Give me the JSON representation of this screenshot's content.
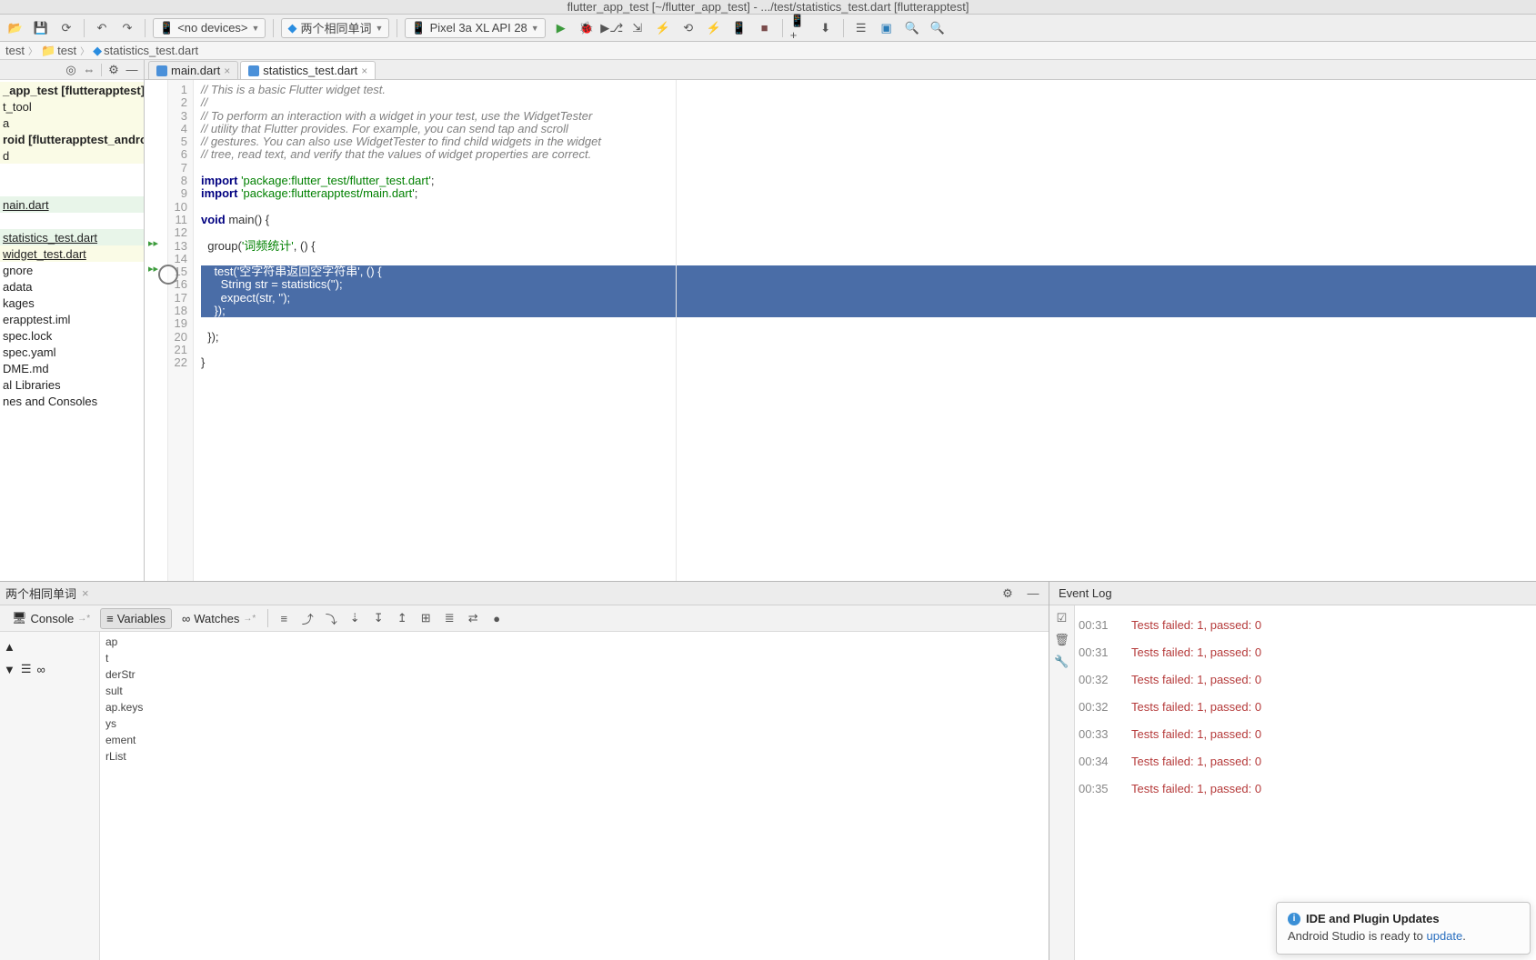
{
  "titlebar": "flutter_app_test [~/flutter_app_test] - .../test/statistics_test.dart [flutterapptest]",
  "toolbar": {
    "device_label": "<no devices>",
    "run_config_label": "两个相同单词",
    "emulator_label": "Pixel 3a XL API 28"
  },
  "breadcrumb": {
    "parts": [
      "test",
      "test",
      "statistics_test.dart"
    ]
  },
  "project": {
    "items": [
      {
        "label": "_app_test [flutterapptest]",
        "hl": "yellow",
        "bold": true
      },
      {
        "label": "t_tool",
        "hl": "yellow"
      },
      {
        "label": "a",
        "hl": "yellow"
      },
      {
        "label": "roid [flutterapptest_android]",
        "hl": "yellow",
        "bold": true
      },
      {
        "label": "d",
        "hl": "yellow"
      },
      {
        "label": ""
      },
      {
        "label": ""
      },
      {
        "label": "nain.dart",
        "hl": "green",
        "ul": true
      },
      {
        "label": ""
      },
      {
        "label": "statistics_test.dart",
        "hl": "green",
        "ul": true
      },
      {
        "label": "widget_test.dart",
        "hl": "yellow",
        "ul": true
      },
      {
        "label": "gnore"
      },
      {
        "label": "adata"
      },
      {
        "label": "kages"
      },
      {
        "label": "erapptest.iml"
      },
      {
        "label": "spec.lock"
      },
      {
        "label": "spec.yaml"
      },
      {
        "label": "DME.md"
      },
      {
        "label": "al Libraries"
      },
      {
        "label": "nes and Consoles"
      }
    ]
  },
  "tabs": [
    {
      "label": "main.dart",
      "active": false
    },
    {
      "label": "statistics_test.dart",
      "active": true
    }
  ],
  "code_lines": [
    {
      "n": 1,
      "segs": [
        {
          "t": "// This is a basic Flutter widget test.",
          "c": "cmt"
        }
      ]
    },
    {
      "n": 2,
      "segs": [
        {
          "t": "//",
          "c": "cmt"
        }
      ]
    },
    {
      "n": 3,
      "segs": [
        {
          "t": "// To perform an interaction with a widget in your test, use the WidgetTester",
          "c": "cmt"
        }
      ]
    },
    {
      "n": 4,
      "segs": [
        {
          "t": "// utility that Flutter provides. For example, you can send tap and scroll",
          "c": "cmt"
        }
      ]
    },
    {
      "n": 5,
      "segs": [
        {
          "t": "// gestures. You can also use WidgetTester to find child widgets in the widget",
          "c": "cmt"
        }
      ]
    },
    {
      "n": 6,
      "segs": [
        {
          "t": "// tree, read text, and verify that the values of widget properties are correct.",
          "c": "cmt"
        }
      ]
    },
    {
      "n": 7,
      "segs": []
    },
    {
      "n": 8,
      "segs": [
        {
          "t": "import ",
          "c": "kw"
        },
        {
          "t": "'package:flutter_test/flutter_test.dart'",
          "c": "str"
        },
        {
          "t": ";"
        }
      ]
    },
    {
      "n": 9,
      "segs": [
        {
          "t": "import ",
          "c": "kw"
        },
        {
          "t": "'package:flutterapptest/main.dart'",
          "c": "str"
        },
        {
          "t": ";"
        }
      ]
    },
    {
      "n": 10,
      "segs": []
    },
    {
      "n": 11,
      "segs": [
        {
          "t": "void ",
          "c": "kw"
        },
        {
          "t": "main() {",
          "c": ""
        }
      ]
    },
    {
      "n": 12,
      "segs": []
    },
    {
      "n": 13,
      "segs": [
        {
          "t": "  group("
        },
        {
          "t": "'词频统计'",
          "c": "str"
        },
        {
          "t": ", () {"
        }
      ]
    },
    {
      "n": 14,
      "segs": []
    },
    {
      "n": 15,
      "sel": true,
      "segs": [
        {
          "t": "    test("
        },
        {
          "t": "'空字符串返回空字符串'",
          "c": "str"
        },
        {
          "t": ", () {"
        }
      ]
    },
    {
      "n": 16,
      "sel": true,
      "segs": [
        {
          "t": "      String str = "
        },
        {
          "t": "statistics",
          "c": "fn"
        },
        {
          "t": "("
        },
        {
          "t": "''",
          "c": "str"
        },
        {
          "t": ");"
        }
      ]
    },
    {
      "n": 17,
      "sel": true,
      "segs": [
        {
          "t": "      expect(str, "
        },
        {
          "t": "''",
          "c": "str"
        },
        {
          "t": ");"
        }
      ]
    },
    {
      "n": 18,
      "sel": true,
      "segs": [
        {
          "t": "    });"
        }
      ]
    },
    {
      "n": 19,
      "segs": []
    },
    {
      "n": 20,
      "segs": [
        {
          "t": "  });"
        }
      ]
    },
    {
      "n": 21,
      "segs": []
    },
    {
      "n": 22,
      "segs": [
        {
          "t": "}"
        }
      ]
    }
  ],
  "debug": {
    "title": "两个相同单词",
    "tabs": {
      "console": "Console",
      "variables": "Variables",
      "watches": "Watches"
    },
    "vars": [
      "ap",
      "t",
      "derStr",
      "sult",
      "ap.keys",
      "ys",
      "ement",
      "rList"
    ]
  },
  "eventlog": {
    "title": "Event Log",
    "rows": [
      {
        "time": "00:31",
        "msg": "Tests failed: 1, passed: 0"
      },
      {
        "time": "00:31",
        "msg": "Tests failed: 1, passed: 0"
      },
      {
        "time": "00:32",
        "msg": "Tests failed: 1, passed: 0"
      },
      {
        "time": "00:32",
        "msg": "Tests failed: 1, passed: 0"
      },
      {
        "time": "00:33",
        "msg": "Tests failed: 1, passed: 0"
      },
      {
        "time": "00:34",
        "msg": "Tests failed: 1, passed: 0"
      },
      {
        "time": "00:35",
        "msg": "Tests failed: 1, passed: 0"
      }
    ]
  },
  "popup": {
    "title": "IDE and Plugin Updates",
    "body_prefix": "Android Studio is ready to ",
    "link": "update",
    "body_suffix": "."
  }
}
